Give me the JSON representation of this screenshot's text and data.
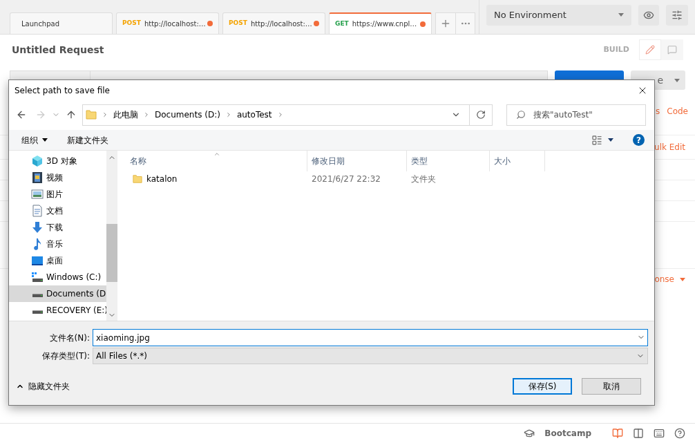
{
  "tabs": [
    {
      "label": "Launchpad",
      "selected": false,
      "unsaved": false
    },
    {
      "method": "POST",
      "color": "#f4a300",
      "label": "http://localhost:…",
      "selected": false,
      "unsaved": true
    },
    {
      "method": "POST",
      "color": "#f4a300",
      "label": "http://localhost:…",
      "selected": false,
      "unsaved": true
    },
    {
      "method": "GET",
      "color": "#26a04c",
      "label": "https://www.cnpl…",
      "selected": true,
      "unsaved": true
    }
  ],
  "environment": {
    "value": "No Environment"
  },
  "request": {
    "title": "Untitled Request",
    "mode": "BUILD",
    "save_fragment": "e"
  },
  "background_links": {
    "code_fragment": "s",
    "code": "Code",
    "bulk_edit": "ulk Edit",
    "response": "onse"
  },
  "status_bar": {
    "bootcamp": "Bootcamp"
  },
  "dialog": {
    "title": "Select path to save file",
    "breadcrumbs": [
      "此电脑",
      "Documents (D:)",
      "autoTest"
    ],
    "search": {
      "placeholder": "搜索\"autoTest\""
    },
    "toolbar": {
      "organize": "组织",
      "new_folder": "新建文件夹",
      "help": "?"
    },
    "sidebar": [
      {
        "kind": "cube",
        "label": "3D 对象",
        "selected": false
      },
      {
        "kind": "video",
        "label": "视频",
        "selected": false
      },
      {
        "kind": "pictures",
        "label": "图片",
        "selected": false
      },
      {
        "kind": "documents",
        "label": "文档",
        "selected": false
      },
      {
        "kind": "downloads",
        "label": "下载",
        "selected": false
      },
      {
        "kind": "music",
        "label": "音乐",
        "selected": false
      },
      {
        "kind": "desktop",
        "label": "桌面",
        "selected": false
      },
      {
        "kind": "windows-drive",
        "label": "Windows (C:)",
        "selected": false
      },
      {
        "kind": "drive",
        "label": "Documents (D",
        "selected": true
      },
      {
        "kind": "drive",
        "label": "RECOVERY (E:)",
        "selected": false
      }
    ],
    "columns": [
      "名称",
      "修改日期",
      "类型",
      "大小"
    ],
    "rows": [
      {
        "name": "katalon",
        "modified": "2021/6/27 22:32",
        "type": "文件夹"
      }
    ],
    "file_name": {
      "label": "文件名(N):",
      "value": "xiaoming.jpg"
    },
    "file_type": {
      "label": "保存类型(T):",
      "value": "All Files (*.*)"
    },
    "hide_folders": "隐藏文件夹",
    "buttons": [
      {
        "label": "保存(S)",
        "default": true
      },
      {
        "label": "取消",
        "default": false
      }
    ]
  }
}
